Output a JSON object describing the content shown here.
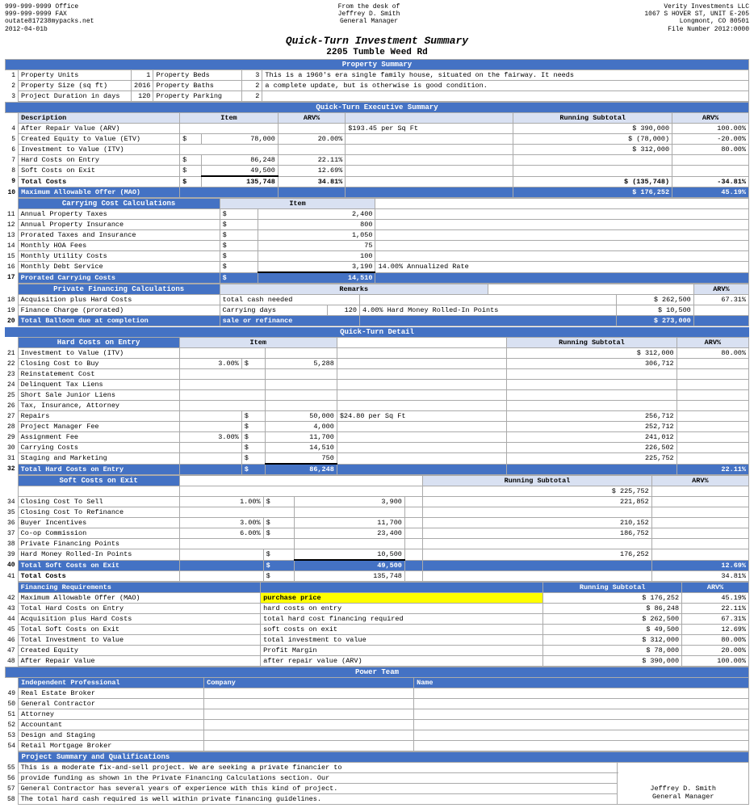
{
  "company": {
    "name": "Verity Investments LLC",
    "address": "1067 S HOVER ST, UNIT E-205",
    "city": "Longmont, CO 80501"
  },
  "contact": {
    "phone1": "999-999-9999 Office",
    "fax": "999-999-9999 FAX",
    "email": "outate817238mypacks.net"
  },
  "from": {
    "label": "From the desk of",
    "name": "Jeffrey D. Smith",
    "title": "General Manager"
  },
  "doc": {
    "date": "2012-04-01b",
    "file_number": "File Number 2012:0000"
  },
  "title": "Quick-Turn Investment Summary",
  "address": "2205 Tumble Weed Rd",
  "property_summary": {
    "header": "Property Summary",
    "rows": [
      {
        "num": "1",
        "label": "Property Units",
        "val1": "1",
        "label2": "Property Beds",
        "val2": "3",
        "note": "This is a 1960's era single family house, situated on the fairway. It needs"
      },
      {
        "num": "2",
        "label": "Property Size (sq ft)",
        "val1": "2016",
        "label2": "Property Baths",
        "val2": "2",
        "note": "a complete update, but is otherwise is good condition."
      },
      {
        "num": "3",
        "label": "Project Duration in days",
        "val1": "120",
        "label2": "Property Parking",
        "val2": "2",
        "note": ""
      }
    ]
  },
  "executive_summary": {
    "header": "Quick-Turn Executive Summary",
    "col_headers": [
      "Description",
      "Item",
      "ARV%",
      "",
      "Running Subtotal",
      "ARV%"
    ],
    "rows": [
      {
        "num": "4",
        "desc": "After Repair Value (ARV)",
        "item": "",
        "arv_pct": "",
        "note": "$193.45 per Sq Ft",
        "running": "390,000",
        "arv2": "100.00%"
      },
      {
        "num": "5",
        "desc": "Created Equity to Value (ETV)",
        "item": "$ 78,000",
        "arv_pct": "20.00%",
        "note": "",
        "running": "(78,000)",
        "arv2": "-20.00%"
      },
      {
        "num": "6",
        "desc": "Investment to Value (ITV)",
        "item": "",
        "arv_pct": "",
        "note": "",
        "running": "312,000",
        "arv2": "80.00%"
      },
      {
        "num": "7",
        "desc": "Hard Costs on Entry",
        "item": "$ 86,248",
        "arv_pct": "22.11%",
        "note": "",
        "running": "",
        "arv2": ""
      },
      {
        "num": "8",
        "desc": "Soft Costs on Exit",
        "item": "$ 49,500",
        "arv_pct": "12.69%",
        "note": "",
        "running": "",
        "arv2": ""
      },
      {
        "num": "9",
        "desc": "Total Costs",
        "item": "$ 135,748",
        "arv_pct": "34.81%",
        "note": "",
        "running": "(135,748)",
        "arv2": "-34.81%",
        "bold": true
      },
      {
        "num": "10",
        "desc": "Maximum Allowable Offer (MAO)",
        "item": "",
        "arv_pct": "",
        "note": "",
        "running": "176,252",
        "arv2": "45.19%",
        "blue": true
      }
    ]
  },
  "carrying_cost": {
    "header": "Carrying Cost Calculations",
    "col2": "Item",
    "rows": [
      {
        "num": "11",
        "desc": "Annual Property Taxes",
        "val": "$ 2,400"
      },
      {
        "num": "12",
        "desc": "Annual Property Insurance",
        "val": "$ 800"
      },
      {
        "num": "13",
        "desc": "Prorated Taxes and Insurance",
        "val": "$ 1,050"
      },
      {
        "num": "14",
        "desc": "Monthly HOA Fees",
        "val": "$ 75"
      },
      {
        "num": "15",
        "desc": "Monthly Utility Costs",
        "val": "$ 100"
      },
      {
        "num": "16",
        "desc": "Monthly Debt Service",
        "val": "$ 3,190",
        "note": "14.00%  Annualized Rate"
      },
      {
        "num": "17",
        "desc": "Prorated Carrying Costs",
        "val": "$ 14,510",
        "blue": true
      }
    ]
  },
  "private_financing": {
    "header": "Private Financing Calculations",
    "remarks_col": "Remarks",
    "arv_col": "ARV%",
    "rows": [
      {
        "num": "18",
        "desc": "Acquisition plus Hard Costs",
        "col2": "total cash needed",
        "col3": "",
        "col4": "",
        "running": "262,500",
        "arv": "67.31%"
      },
      {
        "num": "19",
        "desc": "Finance Charge (prorated)",
        "col2": "Carrying days",
        "col3": "120",
        "col4": "4.00%  Hard Money Rolled-In Points",
        "running": "10,500",
        "arv": ""
      },
      {
        "num": "20",
        "desc": "Total Balloon due at completion",
        "col2": "sale or refinance",
        "col3": "",
        "col4": "",
        "running": "273,000",
        "arv": "",
        "blue": true
      }
    ]
  },
  "detail_header": "Quick-Turn Detail",
  "hard_costs": {
    "header": "Hard Costs on Entry",
    "col_item": "Item",
    "col_running": "Running Subtotal",
    "col_arv": "ARV%",
    "rows": [
      {
        "num": "21",
        "desc": "Investment to Value (ITV)",
        "pct": "",
        "dollar": "",
        "val": "",
        "note": "",
        "running": "312,000",
        "arv": "80.00%"
      },
      {
        "num": "22",
        "desc": "Closing Cost to Buy",
        "pct": "3.00%",
        "dollar": "$",
        "val": "5,288",
        "note": "",
        "running": "306,712",
        "arv": ""
      },
      {
        "num": "23",
        "desc": "Reinstatement Cost",
        "pct": "",
        "dollar": "",
        "val": "",
        "note": "",
        "running": "",
        "arv": ""
      },
      {
        "num": "24",
        "desc": "Delinquent Tax Liens",
        "pct": "",
        "dollar": "",
        "val": "",
        "note": "",
        "running": "",
        "arv": ""
      },
      {
        "num": "25",
        "desc": "Short Sale Junior Liens",
        "pct": "",
        "dollar": "",
        "val": "",
        "note": "",
        "running": "",
        "arv": ""
      },
      {
        "num": "26",
        "desc": "Tax, Insurance, Attorney",
        "pct": "",
        "dollar": "",
        "val": "",
        "note": "",
        "running": "",
        "arv": ""
      },
      {
        "num": "27",
        "desc": "Repairs",
        "pct": "",
        "dollar": "$",
        "val": "50,000",
        "note": "$24.80 per Sq Ft",
        "running": "256,712",
        "arv": ""
      },
      {
        "num": "28",
        "desc": "Project Manager Fee",
        "pct": "",
        "dollar": "$",
        "val": "4,000",
        "note": "",
        "running": "252,712",
        "arv": ""
      },
      {
        "num": "29",
        "desc": "Assignment Fee",
        "pct": "3.00%",
        "dollar": "$",
        "val": "11,700",
        "note": "",
        "running": "241,012",
        "arv": ""
      },
      {
        "num": "30",
        "desc": "Carrying Costs",
        "pct": "",
        "dollar": "$",
        "val": "14,510",
        "note": "",
        "running": "226,502",
        "arv": ""
      },
      {
        "num": "31",
        "desc": "Staging and Marketing",
        "pct": "",
        "dollar": "$",
        "val": "750",
        "note": "",
        "running": "225,752",
        "arv": ""
      },
      {
        "num": "32",
        "desc": "Total Hard Costs on Entry",
        "pct": "",
        "dollar": "$",
        "val": "86,248",
        "note": "",
        "running": "",
        "arv": "22.11%",
        "blue": true
      }
    ]
  },
  "soft_costs": {
    "header": "Soft Costs on Exit",
    "col_running": "Running Subtotal",
    "col_arv": "ARV%",
    "rows": [
      {
        "num": "34",
        "desc": "Closing Cost To Sell",
        "pct": "1.00%",
        "dollar": "$",
        "val": "3,900",
        "note": "",
        "running": "221,852",
        "arv": ""
      },
      {
        "num": "35",
        "desc": "Closing Cost To Refinance",
        "pct": "",
        "dollar": "",
        "val": "",
        "note": "",
        "running": "",
        "arv": ""
      },
      {
        "num": "36",
        "desc": "Buyer Incentives",
        "pct": "3.00%",
        "dollar": "$",
        "val": "11,700",
        "note": "",
        "running": "210,152",
        "arv": ""
      },
      {
        "num": "37",
        "desc": "Co-op Commission",
        "pct": "6.00%",
        "dollar": "$",
        "val": "23,400",
        "note": "",
        "running": "186,752",
        "arv": ""
      },
      {
        "num": "38",
        "desc": "Private Financing Points",
        "pct": "",
        "dollar": "",
        "val": "",
        "note": "",
        "running": "",
        "arv": ""
      },
      {
        "num": "39",
        "desc": "Hard Money Rolled-In Points",
        "pct": "",
        "dollar": "$",
        "val": "10,500",
        "note": "",
        "running": "176,252",
        "arv": ""
      },
      {
        "num": "40",
        "desc": "Total Soft Costs on Exit",
        "pct": "",
        "dollar": "$",
        "val": "49,500",
        "note": "",
        "running": "",
        "arv": "12.69%",
        "blue": true
      }
    ]
  },
  "total_costs": {
    "num": "41",
    "desc": "Total Costs",
    "dollar": "$",
    "val": "135,748",
    "arv": "34.81%"
  },
  "financing_req": {
    "header": "Financing Requirements",
    "col_running": "Running Subtotal",
    "col_arv": "ARV%",
    "rows": [
      {
        "num": "42",
        "desc": "Maximum Allowable Offer (MAO)",
        "note": "purchase price",
        "running": "176,252",
        "arv": "45.19%",
        "yellow": true
      },
      {
        "num": "43",
        "desc": "Total Hard Costs on Entry",
        "note": "hard costs on entry",
        "running": "86,248",
        "arv": "22.11%"
      },
      {
        "num": "44",
        "desc": "Acquisition plus Hard Costs",
        "note": "total hard cost financing required",
        "running": "262,500",
        "arv": "67.31%"
      },
      {
        "num": "45",
        "desc": "Total Soft Costs on Exit",
        "note": "soft costs on exit",
        "running": "49,500",
        "arv": "12.69%"
      },
      {
        "num": "46",
        "desc": "Total Investment to Value",
        "note": "total investment to value",
        "running": "312,000",
        "arv": "80.00%"
      },
      {
        "num": "47",
        "desc": "Created Equity",
        "note": "Profit Margin",
        "running": "78,000",
        "arv": "20.00%"
      },
      {
        "num": "48",
        "desc": "After Repair Value",
        "note": "after repair value (ARV)",
        "running": "390,000",
        "arv": "100.00%"
      }
    ]
  },
  "power_team": {
    "header": "Power Team",
    "col1": "Independent Professional",
    "col2": "Company",
    "col3": "Name",
    "rows": [
      {
        "num": "49",
        "role": "Real Estate Broker"
      },
      {
        "num": "50",
        "role": "General Contractor"
      },
      {
        "num": "51",
        "role": "Attorney"
      },
      {
        "num": "52",
        "role": "Accountant"
      },
      {
        "num": "53",
        "role": "Design and Staging"
      },
      {
        "num": "54",
        "role": "Retail Mortgage Broker"
      }
    ]
  },
  "project_summary": {
    "header": "Project Summary and Qualifications",
    "lines": [
      {
        "num": "55",
        "text": "This is a moderate fix-and-sell project. We are seeking a private financier to"
      },
      {
        "num": "56",
        "text": "provide funding as shown in the Private Financing Calculations section. Our"
      },
      {
        "num": "57",
        "text": "General Contractor has several years of experience with this kind of project."
      },
      {
        "num": "58",
        "text": "The total hard cash required is well within private financing guidelines."
      }
    ],
    "signature_name": "Jeffrey D. Smith",
    "signature_title": "General Manager"
  }
}
